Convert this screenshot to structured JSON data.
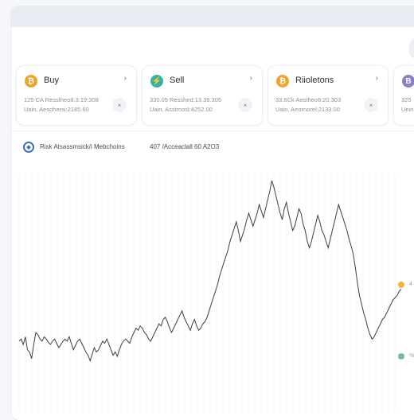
{
  "cards": [
    {
      "title": "Buy",
      "icon": "bitcoin-icon",
      "coin_glyph": "₿",
      "color": "#f0a52a",
      "line1": "125 CA Resstheo8.3.19.308",
      "line2": "Uain, Aesohersi:2185.60",
      "chevron": "›",
      "close": "×"
    },
    {
      "title": "Sell",
      "icon": "ethereum-icon",
      "coin_glyph": "⚡",
      "color": "#33b3a8",
      "line1": "330.05 Resshed:13.39.305",
      "line2": "Uain, Asstmosl:4252.00",
      "chevron": "›",
      "close": "×"
    },
    {
      "title": "Riioletons",
      "icon": "bitcoin-icon",
      "coin_glyph": "₿",
      "color": "#f0a52a",
      "line1": "33.6Ck Aestheo6:20.303",
      "line2": "Uain, Aeornorel:2133.00",
      "chevron": "›",
      "close": "×"
    },
    {
      "title": "",
      "icon": "purple-coin-icon",
      "coin_glyph": "B",
      "color": "#8a7fc8",
      "line1": "325",
      "line2": "Uein",
      "chevron": "",
      "close": ""
    }
  ],
  "chart": {
    "title": "Risk Atsassmsick/i Mebchoins",
    "subtitle": "407 /Acceaclall 60 A2O3",
    "legend": [
      {
        "label": "4",
        "color": "#f2b43a"
      },
      {
        "label": "%",
        "color": "#6fb9b0"
      }
    ]
  },
  "chart_data": {
    "type": "line",
    "grid": true,
    "series": [
      {
        "values": [
          58,
          60,
          55,
          62,
          50,
          48,
          42,
          55,
          66,
          64,
          60,
          58,
          62,
          60,
          57,
          55,
          58,
          60,
          56,
          52,
          55,
          58,
          60,
          58,
          62,
          56,
          50,
          54,
          58,
          60,
          56,
          52,
          48,
          45,
          40,
          46,
          52,
          48,
          50,
          54,
          58,
          56,
          60,
          55,
          50,
          45,
          48,
          44,
          50,
          55,
          58,
          60,
          58,
          56,
          62,
          66,
          70,
          68,
          72,
          70,
          66,
          64,
          60,
          58,
          62,
          66,
          70,
          74,
          72,
          78,
          80,
          76,
          70,
          66,
          70,
          74,
          78,
          82,
          86,
          80,
          76,
          72,
          68,
          74,
          78,
          72,
          68,
          70,
          74,
          76,
          80,
          86,
          92,
          98,
          104,
          110,
          118,
          124,
          130,
          136,
          142,
          150,
          156,
          162,
          168,
          160,
          150,
          156,
          162,
          170,
          176,
          170,
          164,
          170,
          176,
          184,
          178,
          172,
          180,
          188,
          196,
          206,
          200,
          192,
          184,
          176,
          170,
          180,
          186,
          176,
          168,
          160,
          164,
          172,
          180,
          176,
          166,
          160,
          150,
          144,
          150,
          158,
          166,
          174,
          168,
          160,
          156,
          150,
          144,
          152,
          160,
          168,
          176,
          184,
          178,
          172,
          166,
          160,
          152,
          146,
          138,
          126,
          112,
          100,
          92,
          84,
          78,
          70,
          64,
          60,
          62,
          66,
          70,
          74,
          78,
          80,
          84,
          88,
          92,
          96,
          98,
          100,
          104,
          106
        ]
      }
    ]
  }
}
